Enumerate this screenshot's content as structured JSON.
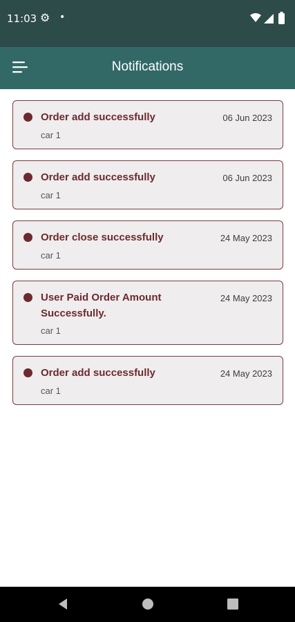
{
  "status_bar": {
    "time": "11:03",
    "settings_icon": "gear-icon",
    "notification_dot": "•",
    "icons": [
      "wifi-icon",
      "signal-icon",
      "battery-icon"
    ]
  },
  "app_bar": {
    "title": "Notifications",
    "menu_icon": "menu-icon",
    "background": "#326966"
  },
  "notifications": [
    {
      "title": "Order add successfully",
      "subtitle": "car 1",
      "date": "06 Jun 2023"
    },
    {
      "title": "Order add successfully",
      "subtitle": "car 1",
      "date": "06 Jun 2023"
    },
    {
      "title": "Order close successfully",
      "subtitle": "car 1",
      "date": "24 May 2023"
    },
    {
      "title": "User Paid Order Amount Successfully.",
      "subtitle": "car 1",
      "date": "24 May 2023"
    },
    {
      "title": "Order add successfully",
      "subtitle": "car 1",
      "date": "24 May 2023"
    }
  ],
  "nav_bar": {
    "buttons": [
      "back-icon",
      "home-icon",
      "recents-icon"
    ]
  },
  "colors": {
    "status_bar": "#2d4b49",
    "accent": "#6b2a30",
    "card_background": "#efeded"
  }
}
